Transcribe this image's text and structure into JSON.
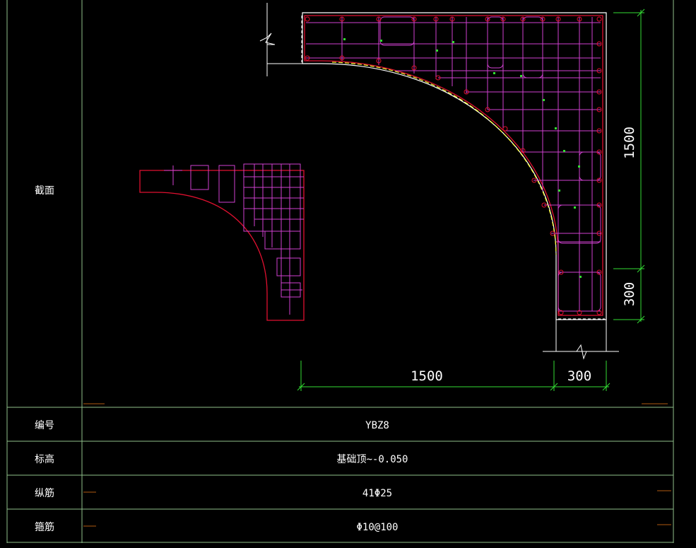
{
  "colors": {
    "background": "#000000",
    "table_line": "#8fbf8a",
    "outline_red": "#e01030",
    "rebar_magenta": "#d040d0",
    "dim_green": "#33dd33",
    "text_white": "#ffffff",
    "yellow": "#ffff33",
    "tag_orange": "#b05a10"
  },
  "table": {
    "section_label": "截面",
    "rows": [
      {
        "label": "编号",
        "value": "YBZ8"
      },
      {
        "label": "标高",
        "value": "基础顶~-0.050"
      },
      {
        "label": "纵筋",
        "value": "41Φ25"
      },
      {
        "label": "箍筋",
        "value": "Φ10@100"
      }
    ]
  },
  "dimensions": {
    "bottom_long": "1500",
    "bottom_short": "300",
    "right_long": "1500",
    "right_short": "300"
  }
}
